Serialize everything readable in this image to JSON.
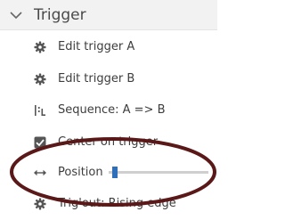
{
  "section": {
    "title": "Trigger",
    "icon": "chevron-down-icon"
  },
  "items": [
    {
      "label": "Edit trigger A",
      "icon": "gear-icon"
    },
    {
      "label": "Edit trigger B",
      "icon": "gear-icon"
    },
    {
      "label": "Sequence: A => B",
      "icon": "sequence-icon"
    },
    {
      "label": "Center on trigger",
      "icon": "checkbox-checked-icon"
    },
    {
      "label": "Position",
      "icon": "horizontal-arrows-icon"
    },
    {
      "label": "Trig'out: Rising edge",
      "icon": "gear-icon"
    }
  ],
  "position_slider": {
    "value_fraction": 0.04
  },
  "colors": {
    "icon": "#555555",
    "slider_thumb": "#2f6fba",
    "slider_track": "#cfcfcf",
    "annotation": "#5a1818"
  }
}
